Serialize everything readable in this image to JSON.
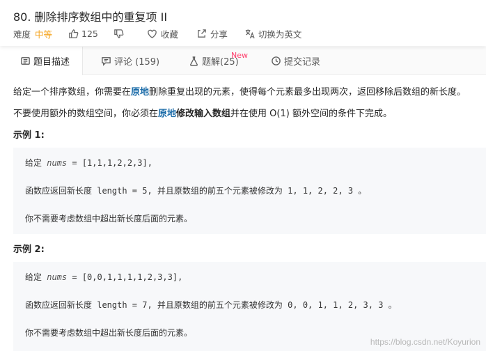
{
  "problem": {
    "title": "80. 删除排序数组中的重复项 II",
    "difficulty_label": "难度",
    "difficulty_value": "中等",
    "likes": "125",
    "favorite_label": "收藏",
    "share_label": "分享",
    "translate_label": "切换为英文"
  },
  "tabs": [
    {
      "label": "题目描述"
    },
    {
      "label": "评论 (159)"
    },
    {
      "label": "题解(25)",
      "badge": "New"
    },
    {
      "label": "提交记录"
    }
  ],
  "description": {
    "p1_a": "给定一个排序数组，你需要在",
    "p1_hl": "原地",
    "p1_b": "删除重复出现的元素，使得每个元素最多出现两次，返回移除后数组的新长度。",
    "p2_a": "不要使用额外的数组空间，你必须在",
    "p2_hl": "原地",
    "p2_bold": "修改输入数组",
    "p2_b": "并在使用 O(1) 额外空间的条件下完成。"
  },
  "examples": [
    {
      "title": "示例 1:",
      "line1_a": "给定 ",
      "line1_var": "nums",
      "line1_b": " = [1,1,1,2,2,3],",
      "line2": "函数应返回新长度 length = 5, 并且原数组的前五个元素被修改为 1, 1, 2, 2, 3 。",
      "line3": "你不需要考虑数组中超出新长度后面的元素。"
    },
    {
      "title": "示例 2:",
      "line1_a": "给定 ",
      "line1_var": "nums",
      "line1_b": " = [0,0,1,1,1,1,2,3,3],",
      "line2": "函数应返回新长度 length = 7, 并且原数组的前五个元素被修改为 0, 0, 1, 1, 2, 3, 3 。",
      "line3": "你不需要考虑数组中超出新长度后面的元素。"
    }
  ],
  "watermark": "https://blog.csdn.net/Koyurion",
  "colors": {
    "difficulty": "#f5a623",
    "highlight": "#1a6ba8",
    "badge": "#ff3d6b"
  }
}
